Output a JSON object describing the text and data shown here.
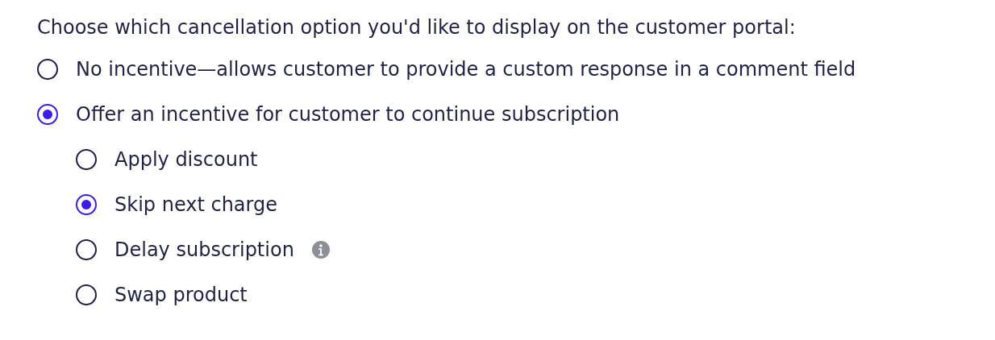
{
  "prompt": "Choose which cancellation option you'd like to display on the customer portal:",
  "options": [
    {
      "label": "No incentive—allows customer to provide a custom response in a comment field",
      "selected": false
    },
    {
      "label": "Offer an incentive for customer to continue subscription",
      "selected": true,
      "children": [
        {
          "label": "Apply discount",
          "selected": false
        },
        {
          "label": "Skip next charge",
          "selected": true
        },
        {
          "label": "Delay subscription",
          "selected": false,
          "info": true
        },
        {
          "label": "Swap product",
          "selected": false
        }
      ]
    }
  ]
}
